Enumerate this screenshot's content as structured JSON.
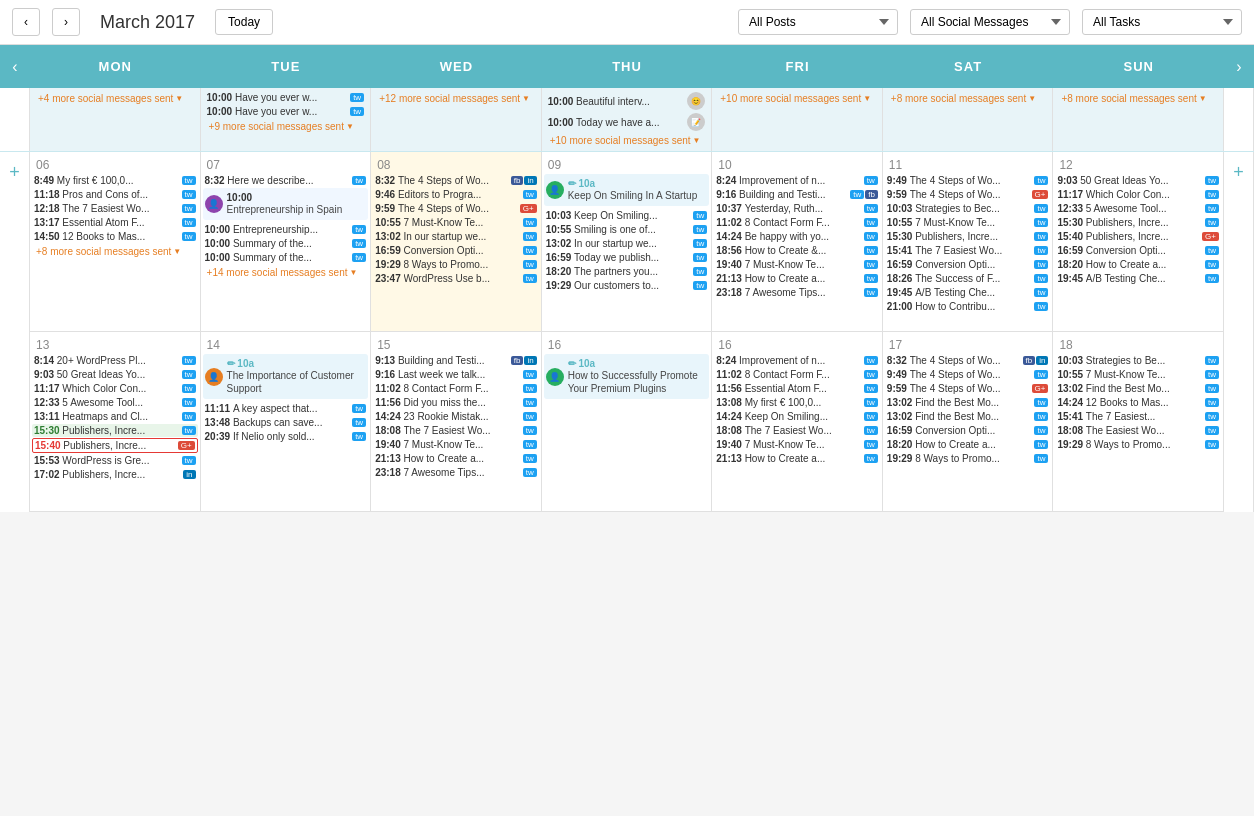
{
  "header": {
    "title": "March 2017",
    "today_label": "Today",
    "filters": {
      "posts": "All Posts",
      "social": "All Social Messages",
      "tasks": "All Tasks"
    }
  },
  "days": [
    "MON",
    "TUE",
    "WED",
    "THU",
    "FRI",
    "SAT",
    "SUN"
  ],
  "weeks": [
    {
      "cells": [
        {
          "num": "",
          "extra": true
        },
        {
          "num": "06"
        },
        {
          "num": "07"
        },
        {
          "num": "08",
          "highlighted": true
        },
        {
          "num": "09"
        },
        {
          "num": "10"
        },
        {
          "num": "11"
        },
        {
          "num": "12"
        }
      ]
    },
    {
      "cells": [
        {
          "num": "",
          "extra": true
        },
        {
          "num": "13"
        },
        {
          "num": "14"
        },
        {
          "num": "15"
        },
        {
          "num": "16"
        },
        {
          "num": "16"
        },
        {
          "num": "17"
        },
        {
          "num": "18"
        }
      ]
    }
  ]
}
